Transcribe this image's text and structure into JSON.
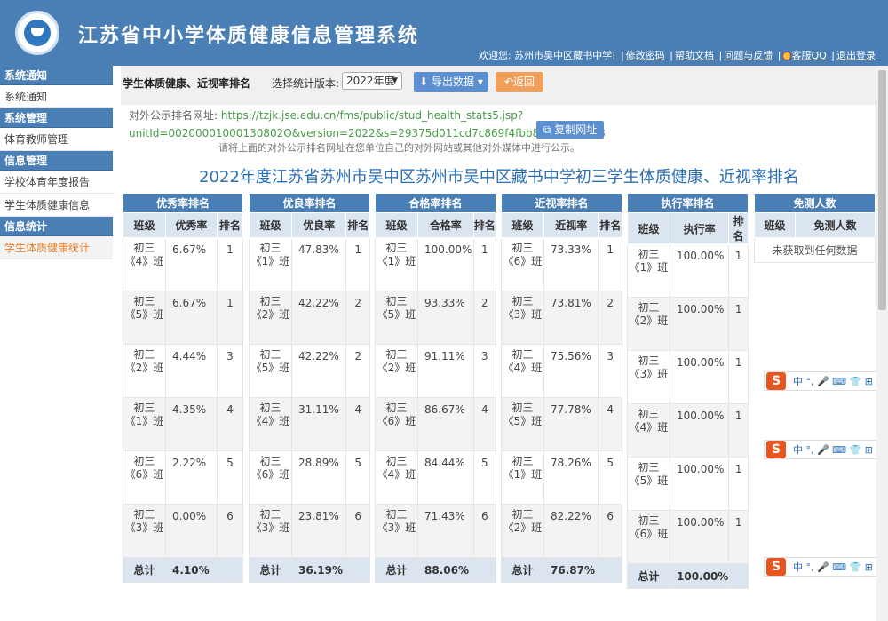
{
  "header": {
    "title": "江苏省中小学体质健康信息管理系统",
    "welcome": "欢迎您: 苏州市吴中区藏书中学!",
    "links": [
      "修改密码",
      "帮助文档",
      "问题与反馈",
      "客服QQ",
      "退出登录"
    ]
  },
  "sidebar": {
    "groups": [
      {
        "title": "系统通知",
        "items": [
          "系统通知"
        ]
      },
      {
        "title": "系统管理",
        "items": [
          "体育教师管理"
        ]
      },
      {
        "title": "信息管理",
        "items": [
          "学校体育年度报告",
          "学生体质健康信息"
        ]
      },
      {
        "title": "信息统计",
        "items": [
          "学生体质健康统计"
        ]
      }
    ]
  },
  "toolbar": {
    "title": "学生体质健康、近视率排名",
    "version_label": "选择统计版本:",
    "version_value": "2022年度",
    "export_label": "导出数据",
    "back_label": "返回"
  },
  "public_url": {
    "label": "对外公示排名网址:",
    "line1": "https://tzjk.jse.edu.cn/fms/public/stud_health_stats5.jsp?",
    "line2": "unitId=00200001000130802O&version=2022&s=29375d011cd7c869f4fbb85c5e6a31e8",
    "copy_label": "复制网址",
    "note": "请将上面的对外公示排名网址在您单位自己的对外网站或其他对外媒体中进行公示。"
  },
  "page_title": "2022年度江苏省苏州市吴中区苏州市吴中区藏书中学初三学生体质健康、近视率排名",
  "col_class": "班级",
  "col_rank": "排名",
  "total_label": "总计",
  "tables": {
    "excellent": {
      "title": "优秀率排名",
      "metric": "优秀率",
      "rows": [
        [
          "初三《4》班",
          "6.67%",
          "1"
        ],
        [
          "初三《5》班",
          "6.67%",
          "1"
        ],
        [
          "初三《2》班",
          "4.44%",
          "3"
        ],
        [
          "初三《1》班",
          "4.35%",
          "4"
        ],
        [
          "初三《6》班",
          "2.22%",
          "5"
        ],
        [
          "初三《3》班",
          "0.00%",
          "6"
        ]
      ],
      "total": "4.10%"
    },
    "good": {
      "title": "优良率排名",
      "metric": "优良率",
      "rows": [
        [
          "初三《1》班",
          "47.83%",
          "1"
        ],
        [
          "初三《2》班",
          "42.22%",
          "2"
        ],
        [
          "初三《5》班",
          "42.22%",
          "2"
        ],
        [
          "初三《4》班",
          "31.11%",
          "4"
        ],
        [
          "初三《6》班",
          "28.89%",
          "5"
        ],
        [
          "初三《3》班",
          "23.81%",
          "6"
        ]
      ],
      "total": "36.19%"
    },
    "pass": {
      "title": "合格率排名",
      "metric": "合格率",
      "rows": [
        [
          "初三《1》班",
          "100.00%",
          "1"
        ],
        [
          "初三《5》班",
          "93.33%",
          "2"
        ],
        [
          "初三《2》班",
          "91.11%",
          "3"
        ],
        [
          "初三《6》班",
          "86.67%",
          "4"
        ],
        [
          "初三《4》班",
          "84.44%",
          "5"
        ],
        [
          "初三《3》班",
          "71.43%",
          "6"
        ]
      ],
      "total": "88.06%"
    },
    "myopia": {
      "title": "近视率排名",
      "metric": "近视率",
      "rows": [
        [
          "初三《6》班",
          "73.33%",
          "1"
        ],
        [
          "初三《3》班",
          "73.81%",
          "2"
        ],
        [
          "初三《4》班",
          "75.56%",
          "3"
        ],
        [
          "初三《5》班",
          "77.78%",
          "4"
        ],
        [
          "初三《1》班",
          "78.26%",
          "5"
        ],
        [
          "初三《2》班",
          "82.22%",
          "6"
        ]
      ],
      "total": "76.87%"
    },
    "execution": {
      "title": "执行率排名",
      "metric": "执行率",
      "rows": [
        [
          "初三《1》班",
          "100.00%",
          "1"
        ],
        [
          "初三《2》班",
          "100.00%",
          "1"
        ],
        [
          "初三《3》班",
          "100.00%",
          "1"
        ],
        [
          "初三《4》班",
          "100.00%",
          "1"
        ],
        [
          "初三《5》班",
          "100.00%",
          "1"
        ],
        [
          "初三《6》班",
          "100.00%",
          "1"
        ]
      ],
      "total": "100.00%"
    },
    "exempt": {
      "title": "免测人数",
      "metric": "免测人数",
      "empty": "未获取到任何数据"
    }
  },
  "ime_toolbar": {
    "logo": "S",
    "glyphs": "中 °, 🎤 ⌨ 👕 ⊞"
  },
  "colors": {
    "header": "#4a7fb5",
    "accent_orange": "#e8812f",
    "title_blue": "#2a6fb5"
  }
}
